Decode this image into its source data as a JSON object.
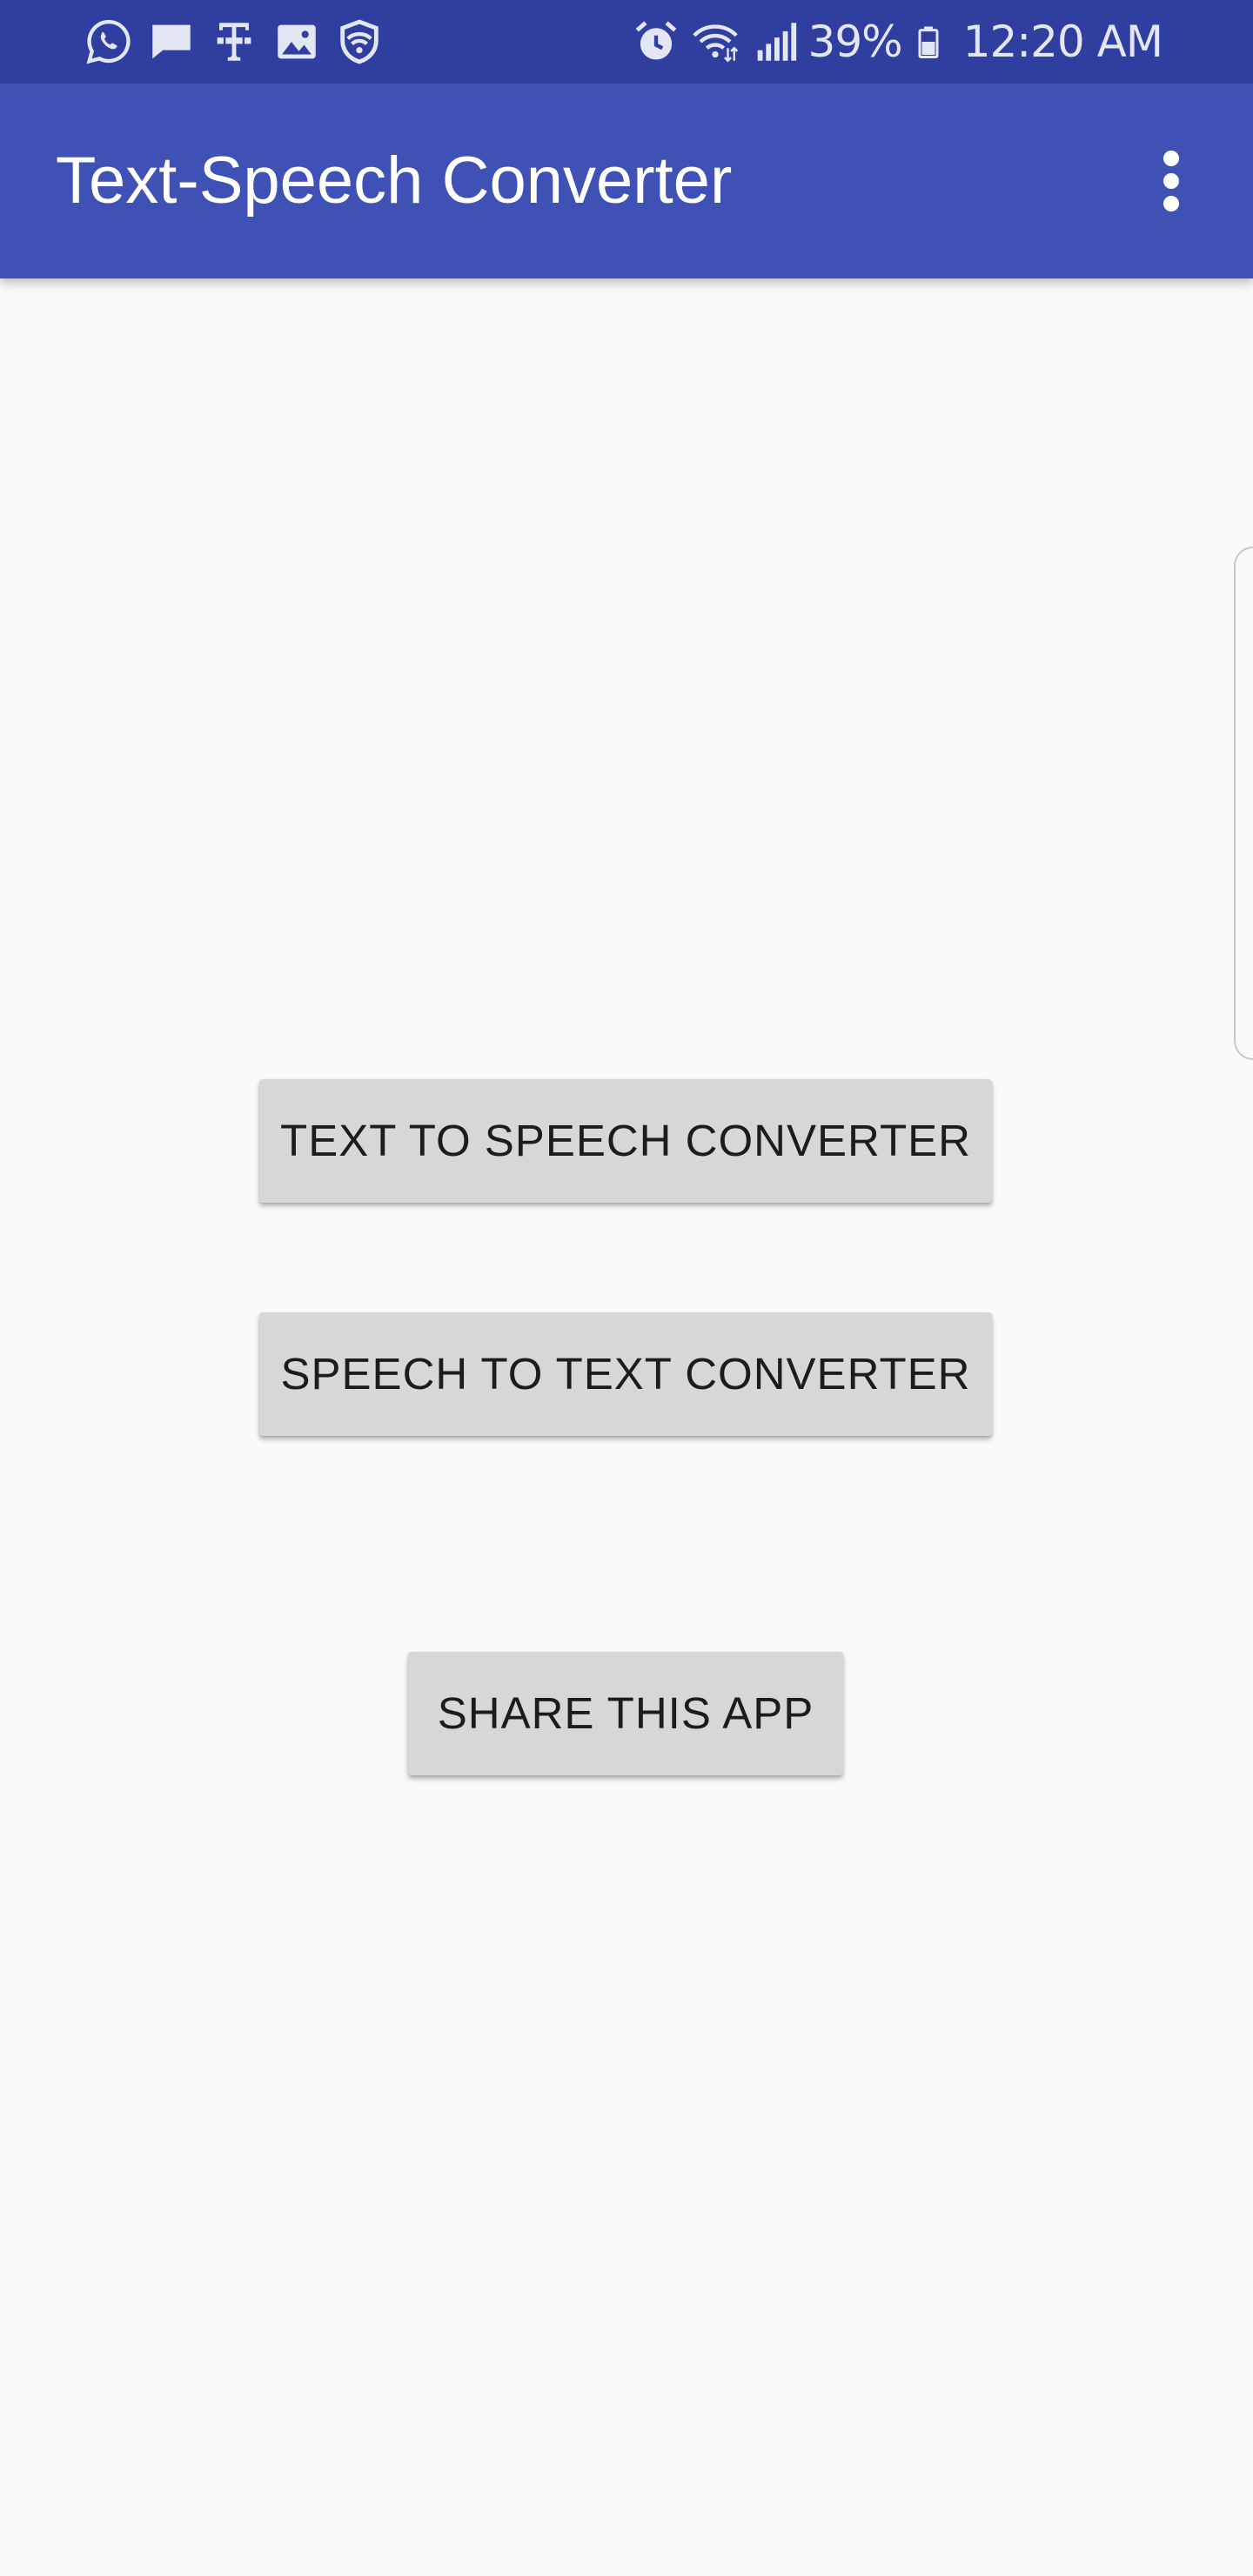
{
  "status_bar": {
    "left_icons": [
      "whatsapp-icon",
      "message-icon",
      "t-mobile-icon",
      "gallery-icon",
      "vpn-shield-icon"
    ],
    "right_icons": [
      "alarm-icon",
      "wifi-icon",
      "signal-icon",
      "battery-icon"
    ],
    "battery_percent": "39%",
    "time": "12:20 AM",
    "background": "#303f9f"
  },
  "app_bar": {
    "title": "Text-Speech Converter",
    "menu_icon": "overflow-menu-icon",
    "background": "#3f51b5"
  },
  "main": {
    "buttons": [
      {
        "label": "TEXT TO SPEECH CONVERTER"
      },
      {
        "label": "SPEECH TO TEXT CONVERTER"
      },
      {
        "label": "SHARE THIS APP"
      }
    ],
    "background": "#fafafa",
    "button_color": "#d6d7d7"
  }
}
